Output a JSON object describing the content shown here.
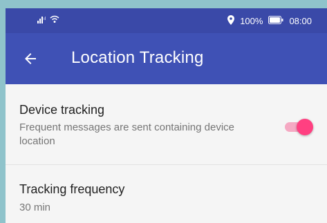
{
  "status_bar": {
    "battery_percent": "100%",
    "time": "08:00",
    "icons": [
      "signal-icon",
      "wifi-icon",
      "location-pin-icon",
      "battery-icon"
    ]
  },
  "app_bar": {
    "title": "Location Tracking",
    "back_icon": "arrow-back-icon",
    "background_color": "#3f51b5",
    "status_color": "#3a49a8"
  },
  "settings": [
    {
      "title": "Device tracking",
      "subtitle": "Frequent messages are sent containing device location",
      "toggle_on": true,
      "accent_color": "#ff4081"
    },
    {
      "title": "Tracking frequency",
      "subtitle": "30 min"
    }
  ]
}
